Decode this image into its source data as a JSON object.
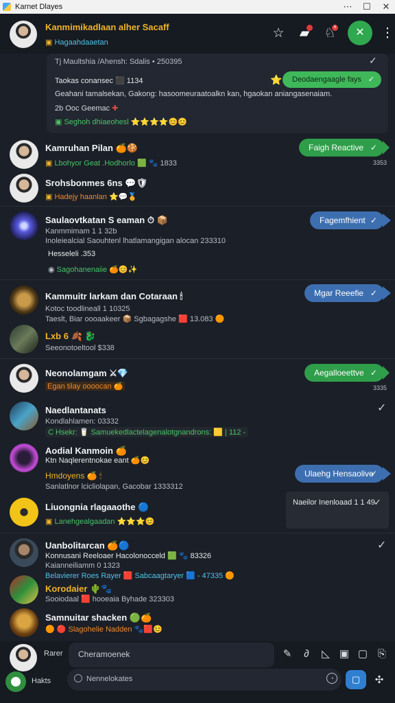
{
  "window": {
    "title": "Karnet Dlayes",
    "controls": [
      "⋯",
      "☐",
      "✕"
    ]
  },
  "header": {
    "name": "Kanmimikadlaan alher Sacaff",
    "subtitle": "Hagaahdaaetan",
    "icons": [
      "star-icon",
      "folder-alert-icon",
      "bell-alert-icon",
      "call-icon",
      "more-icon"
    ],
    "badge": "6"
  },
  "top_card": {
    "heading": "Tj Maultshia /Ahensh: Sdalis • 250395",
    "line2": "Taokas conansec ⬛ 1134",
    "line3": "Geahani tamalsekan, Gakong: hasoomeuraatoalkn kan, hgaokan aniangasenaiam.",
    "line4": "2b Ooc Geemac",
    "footer": "Seghoh dhiaeohesl",
    "footer_emoji": "⭐⭐⭐⭐😊😊",
    "tag": "Deodaengaagle fays",
    "tag_star": "⭐",
    "check": "✓"
  },
  "messages": [
    {
      "name": "Kamruhan Pilan",
      "name_emoji": "🍊🍪",
      "sub": "Lbohyor Geat .Hodhorlo",
      "sub_extra": "🟩 🐾 1833",
      "pill": "Faigh Reactive",
      "pill_color": "green",
      "time": "3353"
    },
    {
      "name": "Srohsbonmes 6ns",
      "name_emoji": "💬🛡",
      "sub": "Hadejy haanlan",
      "sub_extra": "⭐💬🏅"
    },
    {
      "name": "Saulaovtkatan S eaman",
      "name_emoji": "⏱ 📦",
      "line1": "Kanmmimam 1 1 32b",
      "line2": "Inoleiealcial Saouhtenl lhatlamangigan alocan 233310",
      "line3": "Hesseleli  .353",
      "sub": "Sagohanenaiie",
      "sub_extra": "🍊😊✨",
      "pill": "Fagemfhient",
      "pill_color": "blue"
    },
    {
      "name": "Kammuitr larkam dan Cotaraan",
      "name_emoji": "🕯",
      "line1": "Kotoc toodlineall 1 10325",
      "line2": "Taeslt, Biar oooaakeer 📦 Sgbagagshe 🟥 13.083 🟠",
      "pill": "Mgar Reeefie",
      "pill_color": "blue"
    },
    {
      "name": "Lxb 6",
      "name_emoji": "🍂 🐉",
      "line1": "Seeonotoeltool $338"
    },
    {
      "name": "Neonolamgam",
      "name_emoji": "⚔💎",
      "sub": "Egan tilay oooocan",
      "sub_extra": "🍊",
      "pill": "Aegalloeettve",
      "pill_color": "green",
      "time": "3335"
    },
    {
      "name": "Naedlantanats",
      "line1": "Kondlahlamen: 03332",
      "line2": "C Hsekr: 🥛 Samuekedlactelagenalotgnandrons: 🟨 | 112 -"
    },
    {
      "name": "Aodial Kanmoin",
      "name_emoji": "🍊",
      "line1": "Ktn  Naqlerentnokae eant 🍊😊",
      "line2": "Hmdoyens",
      "line2_emoji": "🍊 🕯",
      "line3": "Sanlatlnor lcicliolapan, Gacobar 1333312",
      "pill": "Ulaehg Hensaolive",
      "pill_color": "blue"
    },
    {
      "name": "Liuongnia rlagaaothe",
      "name_emoji": "🔵",
      "sub": "Lanehgealgaadan",
      "sub_extra": "⭐⭐⭐😊",
      "panel": "Naeilor Inenloaad 1 1 49"
    },
    {
      "name": "Uanbolitarcan",
      "name_emoji": "🍊🔵",
      "line1": "Konnusani Reeloaer Hacolonocceld 🟩 🐾 83326",
      "line2": "Kaianneiliamm 0 1323",
      "line3": "Belavierer  Roes Rayer 🟥 Sabcaagtaryer 🟦 - 47335 🟠"
    },
    {
      "name": "Korodaier",
      "name_emoji": "🌵🐾",
      "line1": "Sooiodaal 🟥 hooeaia Byhade 323303"
    },
    {
      "name": "Samnuitar shacken",
      "name_emoji": "🟢🍊",
      "sub": "Slagohelie Nadden",
      "sub_extra": "🐾🟥😊",
      "sub_prefix": "🟠 🔴"
    }
  ],
  "composer": {
    "label": "Rarer",
    "placeholder": "Cheramoenek",
    "tools": [
      "pin-icon",
      "link-icon",
      "edit-icon",
      "image-icon",
      "chat-icon",
      "attach-icon"
    ],
    "bottom_label": "Hakts",
    "bottom_placeholder": "Nennelokates",
    "bottom_icons": [
      "clock-icon",
      "send-icon",
      "puzzle-icon"
    ]
  },
  "colors": {
    "accent_green": "#2f9e4a",
    "accent_blue": "#3d6fb0",
    "gold": "#f0b429",
    "bg": "#1b1f27"
  }
}
